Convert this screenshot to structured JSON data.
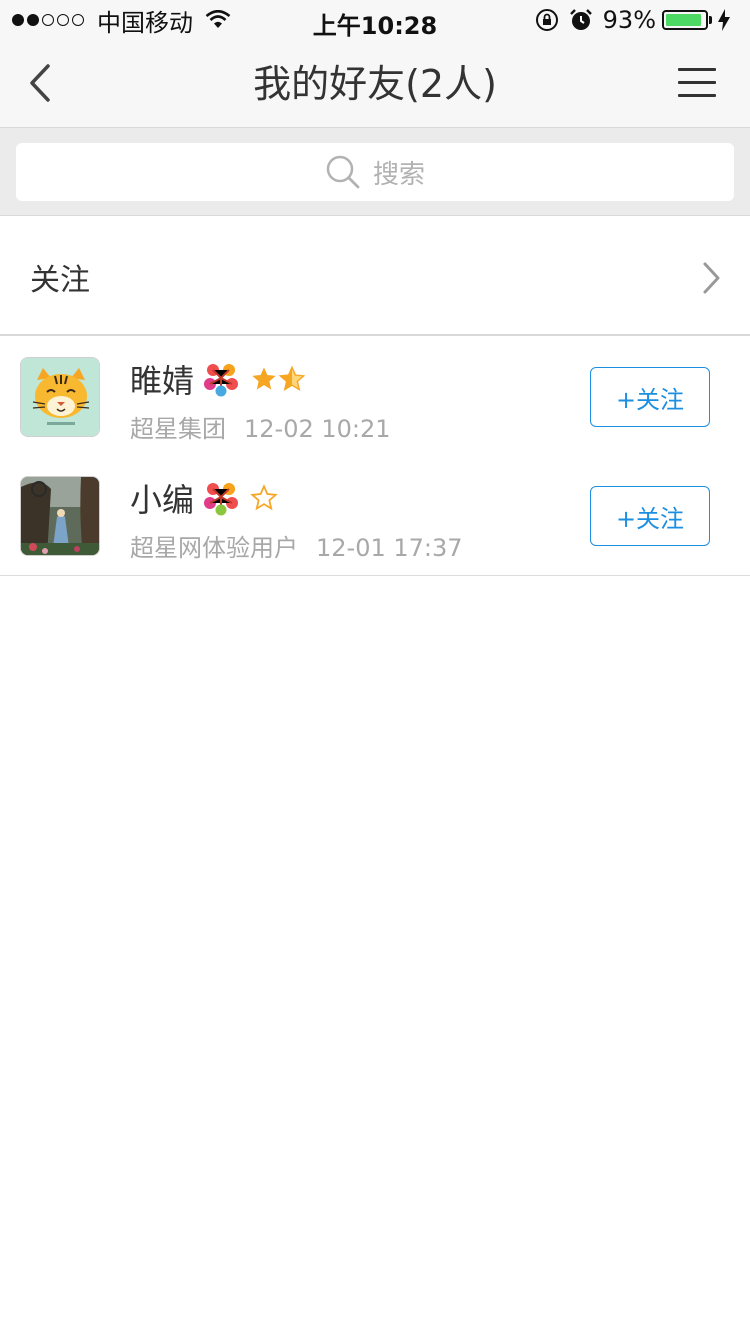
{
  "status_bar": {
    "carrier": "中国移动",
    "time": "上午10:28",
    "battery": "93%",
    "battery_level": 0.93,
    "signal_bars": 2
  },
  "nav": {
    "title": "我的好友(2人)",
    "back_icon": "chevron-left-icon",
    "menu_icon": "hamburger-menu-icon"
  },
  "search": {
    "placeholder": "搜索"
  },
  "follow_entry": {
    "label": "关注"
  },
  "friends": [
    {
      "name": "睢婧",
      "group": "超星集团",
      "time": "12-02 10:21",
      "button": "+关注",
      "stars": 1.5,
      "medal_center": "#4aa8e0"
    },
    {
      "name": "小编",
      "group": "超星网体验用户",
      "time": "12-01 17:37",
      "button": "+关注",
      "stars": 0,
      "medal_center": "#8cc63f"
    }
  ],
  "colors": {
    "accent": "#1d8fe0",
    "star": "#f5a623",
    "battery": "#4cd964"
  }
}
